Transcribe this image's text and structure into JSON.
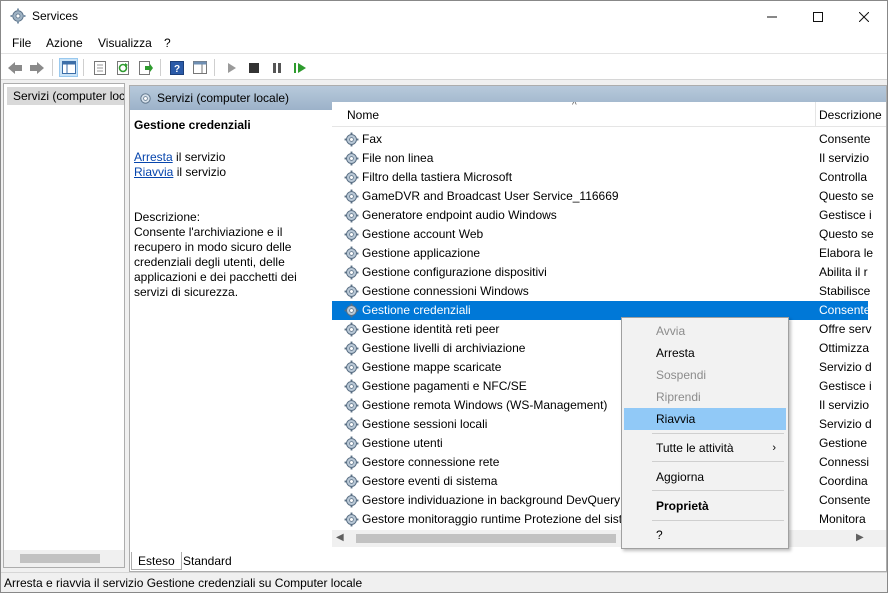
{
  "window": {
    "title": "Services"
  },
  "menu": [
    "File",
    "Azione",
    "Visualizza",
    "?"
  ],
  "tree": {
    "root_label": "Servizi (computer locale)"
  },
  "pane_header": "Servizi (computer locale)",
  "details": {
    "service_name": "Gestione credenziali",
    "stop_link": "Arresta",
    "stop_suffix": " il servizio",
    "restart_link": "Riavvia",
    "restart_suffix": " il servizio",
    "description_label": "Descrizione:",
    "description_text": "Consente l'archiviazione e il recupero in modo sicuro delle credenziali degli utenti, delle applicazioni e dei pacchetti dei servizi di sicurezza."
  },
  "columns": {
    "name": "Nome",
    "description": "Descrizione"
  },
  "services": [
    {
      "name": "Fax",
      "desc": "Consente"
    },
    {
      "name": "File non linea",
      "desc": "Il servizio"
    },
    {
      "name": "Filtro della tastiera Microsoft",
      "desc": "Controlla"
    },
    {
      "name": "GameDVR and Broadcast User Service_116669",
      "desc": "Questo se"
    },
    {
      "name": "Generatore endpoint audio Windows",
      "desc": "Gestisce i"
    },
    {
      "name": "Gestione account Web",
      "desc": "Questo se"
    },
    {
      "name": "Gestione applicazione",
      "desc": "Elabora le"
    },
    {
      "name": "Gestione configurazione dispositivi",
      "desc": "Abilita il r"
    },
    {
      "name": "Gestione connessioni Windows",
      "desc": "Stabilisce"
    },
    {
      "name": "Gestione credenziali",
      "desc": "Consente",
      "selected": true
    },
    {
      "name": "Gestione identità reti peer",
      "desc": "Offre serv"
    },
    {
      "name": "Gestione livelli di archiviazione",
      "desc": "Ottimizza"
    },
    {
      "name": "Gestione mappe scaricate",
      "desc": "Servizio d"
    },
    {
      "name": "Gestione pagamenti e NFC/SE",
      "desc": "Gestisce i"
    },
    {
      "name": "Gestione remota Windows (WS-Management)",
      "desc": "Il servizio"
    },
    {
      "name": "Gestione sessioni locali",
      "desc": "Servizio d"
    },
    {
      "name": "Gestione utenti",
      "desc": "Gestione"
    },
    {
      "name": "Gestore connessione rete",
      "desc": "Connessi"
    },
    {
      "name": "Gestore eventi di sistema",
      "desc": "Coordina"
    },
    {
      "name": "Gestore individuazione in background DevQuery",
      "desc": "Consente"
    },
    {
      "name": "Gestore monitoraggio runtime Protezione del sistema",
      "desc": "Monitora"
    }
  ],
  "context_menu": {
    "items": [
      {
        "label": "Avvia",
        "state": "disabled"
      },
      {
        "label": "Arresta",
        "state": "enabled"
      },
      {
        "label": "Sospendi",
        "state": "disabled"
      },
      {
        "label": "Riprendi",
        "state": "disabled"
      },
      {
        "label": "Riavvia",
        "state": "highlighted"
      },
      {
        "label": "Tutte le attività",
        "state": "submenu"
      },
      {
        "label": "Aggiorna",
        "state": "enabled"
      },
      {
        "label": "Proprietà",
        "state": "bold"
      },
      {
        "label": "?",
        "state": "enabled"
      }
    ]
  },
  "tabs": [
    "Esteso",
    "Standard"
  ],
  "status": "Arresta e riavvia il servizio Gestione credenziali su Computer locale",
  "colors": {
    "selection": "#0078d7",
    "menu_highlight": "#91c9f7",
    "header_band": "#a9bed3"
  }
}
